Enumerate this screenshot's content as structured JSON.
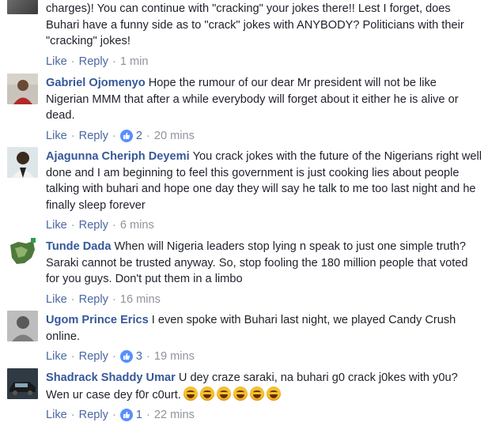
{
  "comments": [
    {
      "author": "",
      "text": "charges)! You can continue with \"cracking\" your jokes there!! Lest I forget, does Buhari have a funny side as to \"crack\" jokes with ANYBODY? Politicians with their \"cracking\" jokes!",
      "like_label": "Like",
      "reply_label": "Reply",
      "likes": "",
      "time": "1 min"
    },
    {
      "author": "Gabriel Ojomenyo",
      "text": "Hope the rumour of our dear Mr president will not be like Nigerian MMM that after a while everybody will forget about it either he is alive or dead.",
      "like_label": "Like",
      "reply_label": "Reply",
      "likes": "2",
      "time": "20 mins"
    },
    {
      "author": "Ajagunna Cheriph Deyemi",
      "text": "You crack jokes with the future of the Nigerians right well done and I am beginning to feel this government is just cooking lies about people talking with buhari and hope one day they will say he talk to me too last night and he finally sleep forever",
      "like_label": "Like",
      "reply_label": "Reply",
      "likes": "",
      "time": "6 mins"
    },
    {
      "author": "Tunde Dada",
      "text": "When will Nigeria leaders stop lying n speak to just one simple truth? Saraki cannot be trusted anyway. So, stop fooling the 180 million people that voted for you guys. Don't put them in a limbo",
      "like_label": "Like",
      "reply_label": "Reply",
      "likes": "",
      "time": "16 mins"
    },
    {
      "author": "Ugom Prince Erics",
      "text": "I even spoke with Buhari last night, we played Candy Crush online.",
      "like_label": "Like",
      "reply_label": "Reply",
      "likes": "3",
      "time": "19 mins"
    },
    {
      "author": "Shadrack Shaddy Umar",
      "text": "U dey craze saraki, na buhari g0 crack j0kes with y0u? Wen ur case dey f0r c0urt.",
      "like_label": "Like",
      "reply_label": "Reply",
      "likes": "1",
      "time": "22 mins",
      "emoji": "laughing-face-icon"
    }
  ],
  "colors": {
    "author": "#365899",
    "action_link": "#4b67a1",
    "meta": "#90949c",
    "like_badge": "#5890ff"
  }
}
